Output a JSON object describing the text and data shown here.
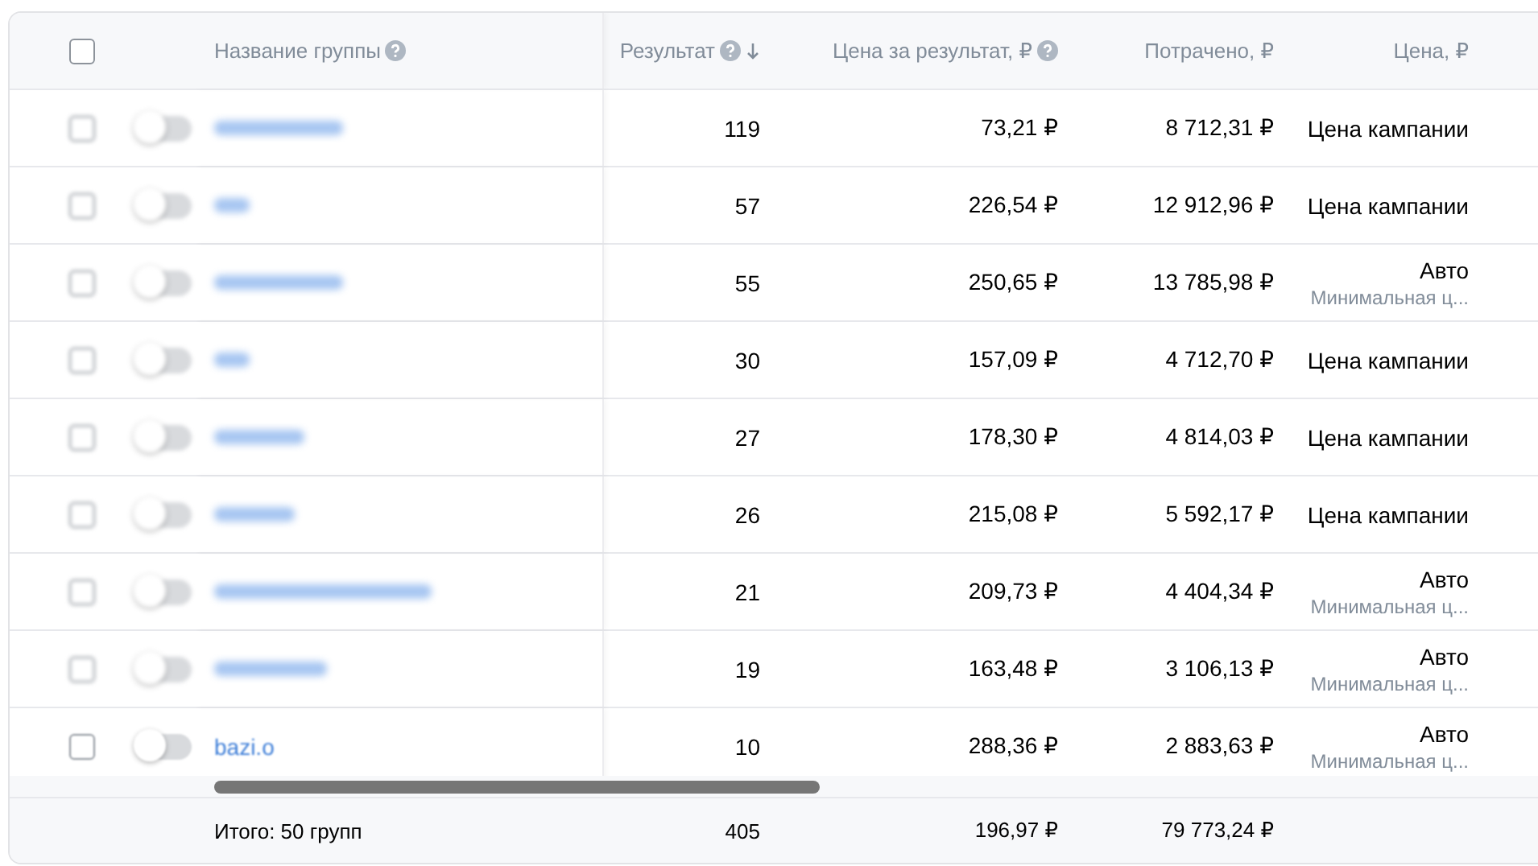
{
  "header": {
    "select_all_checked": false,
    "columns": [
      {
        "label": "Название группы",
        "help": true,
        "sorted": false
      },
      {
        "label": "Результат",
        "help": true,
        "sorted": true
      },
      {
        "label": "Цена за результат, ₽",
        "help": true,
        "sorted": false
      },
      {
        "label": "Потрачено, ₽",
        "help": false,
        "sorted": false
      },
      {
        "label": "Цена, ₽",
        "help": false,
        "sorted": false
      }
    ]
  },
  "rows": [
    {
      "blurred": true,
      "checked": false,
      "on": false,
      "result": "119",
      "cost_per_result": "73,21 ₽",
      "spent": "8 712,31 ₽",
      "price": "Цена кампании"
    },
    {
      "blurred": true,
      "checked": false,
      "on": false,
      "result": "57",
      "cost_per_result": "226,54 ₽",
      "spent": "12 912,96 ₽",
      "price": "Цена кампании"
    },
    {
      "blurred": true,
      "checked": false,
      "on": false,
      "result": "55",
      "cost_per_result": "250,65 ₽",
      "spent": "13 785,98 ₽",
      "price": "Авто",
      "price_note": "Минимальная ц..."
    },
    {
      "blurred": true,
      "checked": false,
      "on": false,
      "result": "30",
      "cost_per_result": "157,09 ₽",
      "spent": "4 712,70 ₽",
      "price": "Цена кампании"
    },
    {
      "blurred": true,
      "checked": false,
      "on": false,
      "result": "27",
      "cost_per_result": "178,30 ₽",
      "spent": "4 814,03 ₽",
      "price": "Цена кампании"
    },
    {
      "blurred": true,
      "checked": false,
      "on": false,
      "result": "26",
      "cost_per_result": "215,08 ₽",
      "spent": "5 592,17 ₽",
      "price": "Цена кампании"
    },
    {
      "blurred": true,
      "checked": false,
      "on": false,
      "result": "21",
      "cost_per_result": "209,73 ₽",
      "spent": "4 404,34 ₽",
      "price": "Авто",
      "price_note": "Минимальная ц..."
    },
    {
      "blurred": true,
      "checked": false,
      "on": false,
      "result": "19",
      "cost_per_result": "163,48 ₽",
      "spent": "3 106,13 ₽",
      "price": "Авто",
      "price_note": "Минимальная ц..."
    },
    {
      "blurred": false,
      "checked": false,
      "on": false,
      "name": "bazi.o",
      "result": "10",
      "cost_per_result": "288,36 ₽",
      "spent": "2 883,63 ₽",
      "price": "Авто",
      "price_note": "Минимальная ц..."
    }
  ],
  "footer": {
    "label": "Итого: 50 групп",
    "result": "405",
    "cost_per_result": "196,97 ₽",
    "spent": "79 773,24 ₽"
  }
}
